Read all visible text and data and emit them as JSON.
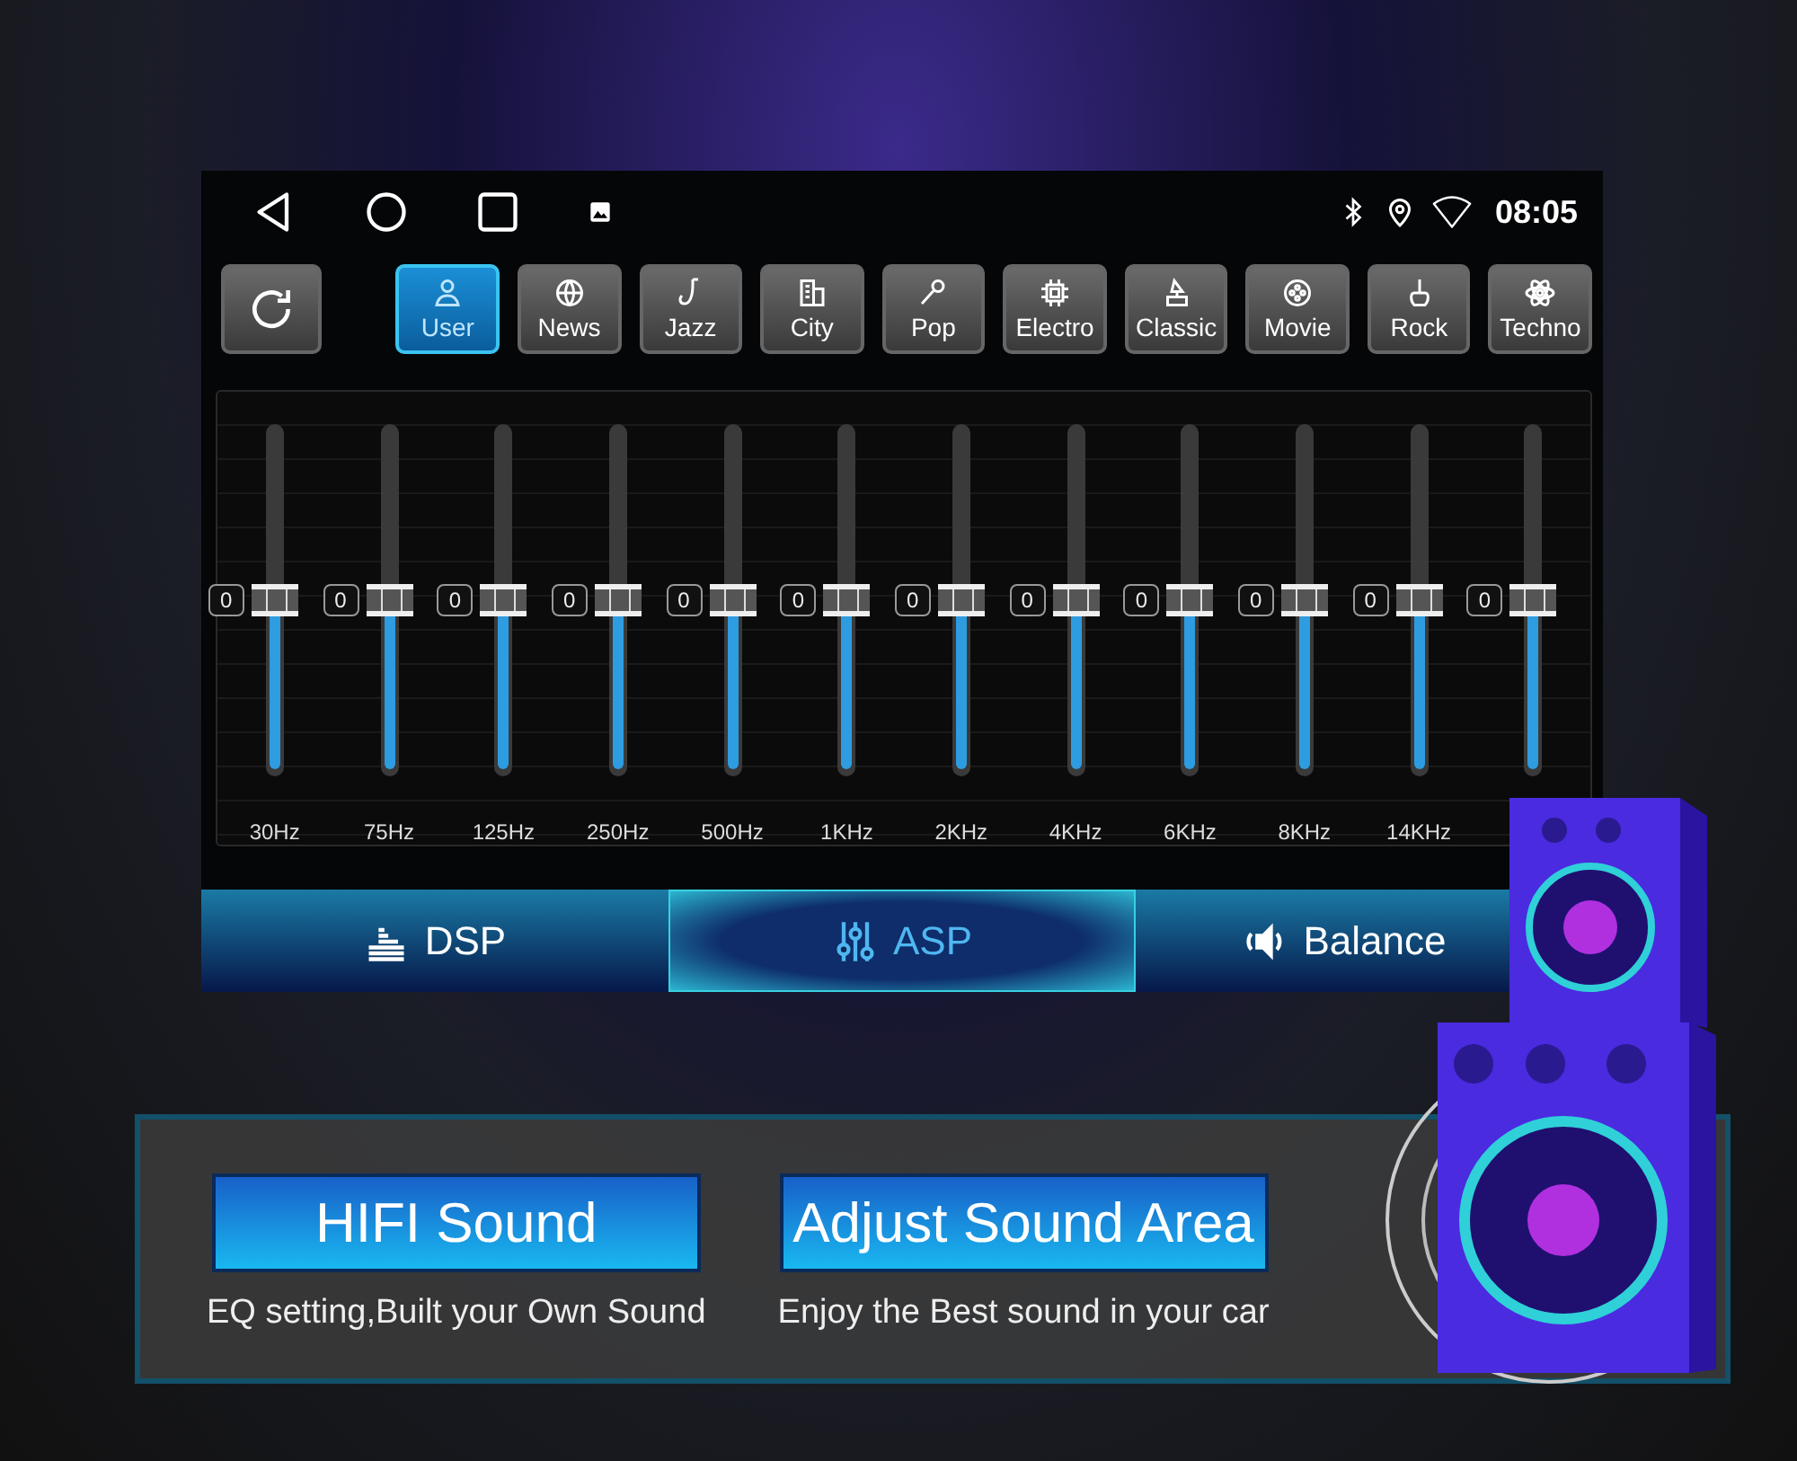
{
  "status_bar": {
    "time": "08:05"
  },
  "presets": [
    {
      "label": "User",
      "kind": "user",
      "selected": true
    },
    {
      "label": "News",
      "kind": "news",
      "selected": false
    },
    {
      "label": "Jazz",
      "kind": "jazz",
      "selected": false
    },
    {
      "label": "City",
      "kind": "city",
      "selected": false
    },
    {
      "label": "Pop",
      "kind": "pop",
      "selected": false
    },
    {
      "label": "Electro",
      "kind": "electro",
      "selected": false
    },
    {
      "label": "Classic",
      "kind": "classic",
      "selected": false
    },
    {
      "label": "Movie",
      "kind": "movie",
      "selected": false
    },
    {
      "label": "Rock",
      "kind": "rock",
      "selected": false
    },
    {
      "label": "Techno",
      "kind": "techno",
      "selected": false
    }
  ],
  "bands": [
    {
      "value": "0",
      "level": 0.5,
      "freq": "30Hz"
    },
    {
      "value": "0",
      "level": 0.5,
      "freq": "75Hz"
    },
    {
      "value": "0",
      "level": 0.5,
      "freq": "125Hz"
    },
    {
      "value": "0",
      "level": 0.5,
      "freq": "250Hz"
    },
    {
      "value": "0",
      "level": 0.5,
      "freq": "500Hz"
    },
    {
      "value": "0",
      "level": 0.5,
      "freq": "1KHz"
    },
    {
      "value": "0",
      "level": 0.5,
      "freq": "2KHz"
    },
    {
      "value": "0",
      "level": 0.5,
      "freq": "4KHz"
    },
    {
      "value": "0",
      "level": 0.5,
      "freq": "6KHz"
    },
    {
      "value": "0",
      "level": 0.5,
      "freq": "8KHz"
    },
    {
      "value": "0",
      "level": 0.5,
      "freq": "14KHz"
    },
    {
      "value": "0",
      "level": 0.5
    }
  ],
  "tabs": [
    {
      "label": "DSP",
      "kind": "bars",
      "selected": false
    },
    {
      "label": "ASP",
      "kind": "sliders",
      "selected": true
    },
    {
      "label": "Balance",
      "kind": "speaker",
      "selected": false
    }
  ],
  "features": [
    {
      "title": "HIFI Sound",
      "caption": "EQ setting,Built your Own Sound"
    },
    {
      "title": "Adjust Sound Area",
      "caption": "Enjoy the Best sound in your car"
    }
  ]
}
